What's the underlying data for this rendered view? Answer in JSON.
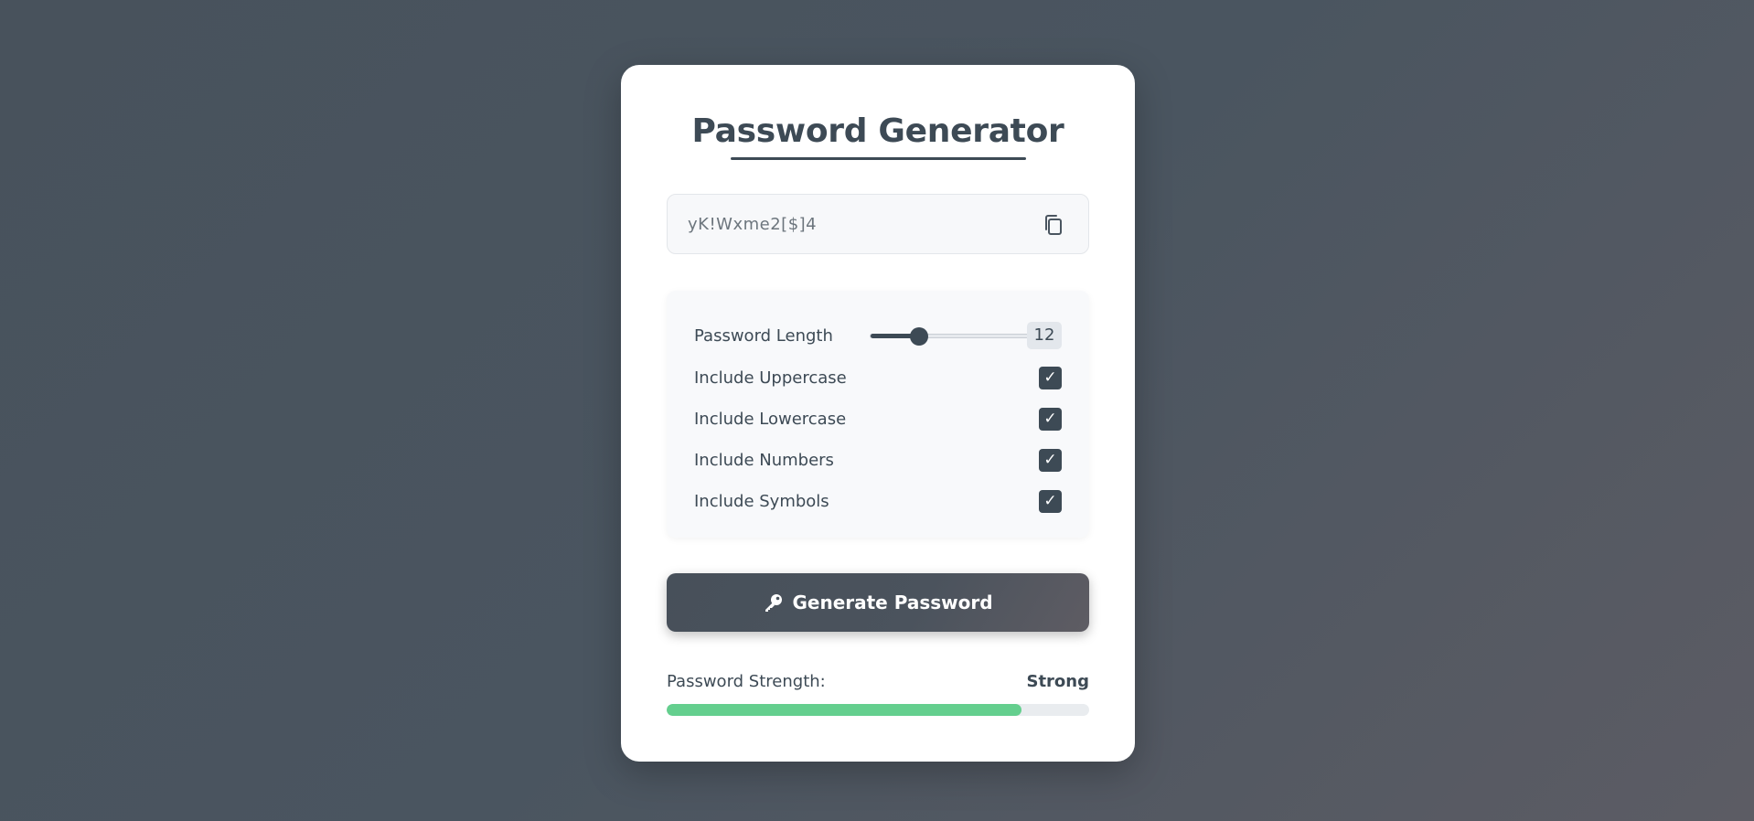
{
  "app": {
    "title": "Password Generator"
  },
  "password": {
    "value": "yK!Wxme2[$]4",
    "copy_icon": "copy-icon"
  },
  "options": {
    "length": {
      "label": "Password Length",
      "value": "12",
      "min": 4,
      "max": 32
    },
    "items": [
      {
        "label": "Include Uppercase",
        "checked": true
      },
      {
        "label": "Include Lowercase",
        "checked": true
      },
      {
        "label": "Include Numbers",
        "checked": true
      },
      {
        "label": "Include Symbols",
        "checked": true
      }
    ],
    "check_glyph": "✓"
  },
  "generate": {
    "label": "Generate Password",
    "icon": "key-icon"
  },
  "strength": {
    "label": "Password Strength:",
    "value": "Strong",
    "level": 0.84,
    "color": "#64cf8e"
  },
  "colors": {
    "accent": "#3d4a55",
    "background": "#4a5560"
  }
}
